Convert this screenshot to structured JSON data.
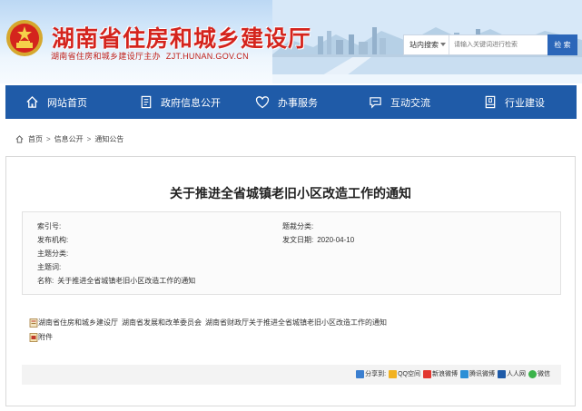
{
  "header": {
    "title": "湖南省住房和城乡建设厅",
    "subtitle": "湖南省住房和城乡建设厅主办",
    "domain": "ZJT.HUNAN.GOV.CN"
  },
  "search": {
    "scope": "站内搜索",
    "placeholder": "请输入关键词进行检索",
    "button": "检 索"
  },
  "nav": [
    {
      "label": "网站首页",
      "icon": "home-icon"
    },
    {
      "label": "政府信息公开",
      "icon": "document-icon"
    },
    {
      "label": "办事服务",
      "icon": "heart-icon"
    },
    {
      "label": "互动交流",
      "icon": "chat-icon"
    },
    {
      "label": "行业建设",
      "icon": "building-icon"
    }
  ],
  "breadcrumb": [
    "首页",
    "信息公开",
    "通知公告"
  ],
  "article": {
    "title": "关于推进全省城镇老旧小区改造工作的通知",
    "meta": {
      "index_label": "索引号:",
      "index_value": "",
      "category_label": "题裁分类:",
      "category_value": "",
      "publisher_label": "发布机构:",
      "publisher_value": "",
      "date_label": "发文日期:",
      "date_value": "2020-04-10",
      "topic_label": "主题分类:",
      "topic_value": "",
      "keywords_label": "主题词:",
      "keywords_value": "",
      "name_label": "名称:",
      "name_value": "关于推进全省城镇老旧小区改造工作的通知"
    },
    "relations": [
      "湖南省住房和城乡建设厅",
      "湖南省发展和改革委员会",
      "湖南省财政厅关于推进全省城镇老旧小区改造工作的通知"
    ],
    "attachment_label": "附件"
  },
  "share": {
    "label": "分享到:",
    "items": [
      {
        "label": "QQ空间",
        "color": "#f2b221"
      },
      {
        "label": "新浪微博",
        "color": "#e2362f"
      },
      {
        "label": "腾讯微博",
        "color": "#2b8fd6"
      },
      {
        "label": "人人网",
        "color": "#1f5ba8"
      },
      {
        "label": "微信",
        "color": "#3bb34a"
      }
    ]
  },
  "colors": {
    "brand_red": "#d4241d",
    "nav_blue": "#1f5ba8",
    "button_blue": "#2b66b9"
  }
}
